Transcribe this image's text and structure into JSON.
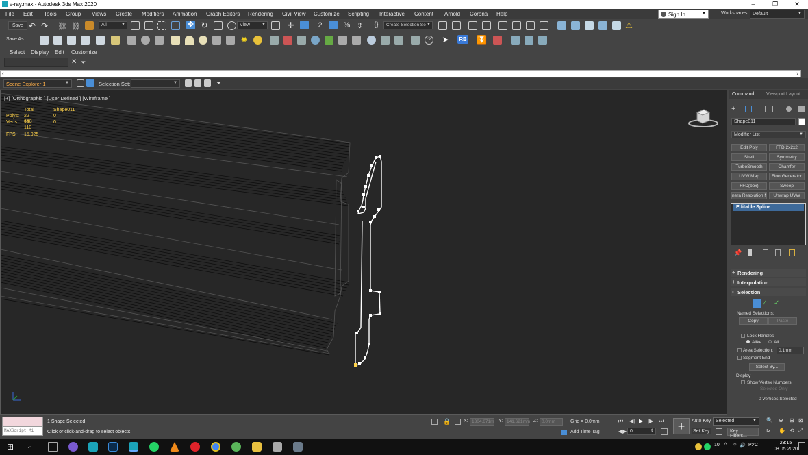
{
  "window": {
    "title": "v-ray.max - Autodesk 3ds Max 2020",
    "min": "–",
    "max": "❐",
    "close": "✕"
  },
  "menu": [
    "File",
    "Edit",
    "Tools",
    "Group",
    "Views",
    "Create",
    "Modifiers",
    "Animation",
    "Graph Editors",
    "Rendering",
    "Civil View",
    "Customize",
    "Scripting",
    "Interactive",
    "Content",
    "Arnold",
    "Corona",
    "Help"
  ],
  "account": {
    "sign_in": "Sign In",
    "workspaces_label": "Workspaces:",
    "workspace": "Default"
  },
  "toolbar": {
    "save": "Save",
    "save_as": "Save As...",
    "filter": "All",
    "view": "View",
    "create_selection_set": "Create Selection Se",
    "rb": "RB"
  },
  "scene_menu": [
    "Select",
    "Display",
    "Edit",
    "Customize"
  ],
  "scene_explorer": {
    "name": "Scene Explorer 1",
    "selection_set_label": "Selection Set:"
  },
  "viewport": {
    "label": "[+] [Orthographic ] [User Defined ] [Wireframe ]",
    "stats": {
      "total_label": "Total",
      "object": "Shape011",
      "polys_label": "Polys:",
      "polys_total": "22 658",
      "polys_obj": "0",
      "verts_label": "Verts:",
      "verts_total": "23 110",
      "verts_obj": "0",
      "fps_label": "FPS:",
      "fps": "15,925"
    }
  },
  "command_panel": {
    "tab_command": "Command ...",
    "tab_layout": "Viewport Layout...",
    "object_name": "Shape011",
    "modifier_list": "Modifier List",
    "modifiers": [
      "Edit Poly",
      "FFD 2x2x2",
      "Shell",
      "Symmetry",
      "TurboSmooth",
      "Chamfer",
      "UVW Map",
      "FloorGenerator",
      "FFD(box)",
      "Sweep",
      "nera Resolution M",
      "Unwrap UVW"
    ],
    "stack_item": "Editable Spline",
    "rollouts": [
      "Rendering",
      "Interpolation",
      "Selection"
    ],
    "named_selections": "Named Selections:",
    "copy": "Copy",
    "paste": "Paste",
    "lock_handles": "Lock Handles",
    "alike": "Alike",
    "all": "All",
    "area_selection": "Area Selection:",
    "area_value": "0,1mm",
    "segment_end": "Segment End",
    "select_by": "Select By...",
    "display": "Display",
    "show_vertex_numbers": "Show Vertex Numbers",
    "selected_only": "Selected Only",
    "vertices_selected": "0 Vertices Selected"
  },
  "status": {
    "maxscript": "MAXScript Mi",
    "shapes_selected": "1 Shape Selected",
    "hint": "Click or click-and-drag to select objects",
    "x_label": "X:",
    "x": "1304,671m",
    "y_label": "Y:",
    "y": "141,621mm",
    "z_label": "Z:",
    "z": "0,0mm",
    "grid": "Grid = 0,0mm",
    "add_time_tag": "Add Time Tag",
    "frame": "0",
    "auto_key": "Auto Key",
    "set_key": "Set Key",
    "selected": "Selected",
    "key_filters": "Key Filters..."
  },
  "taskbar": {
    "lang": "РУС",
    "time": "23:15",
    "date": "08.05.2020",
    "num": "10"
  }
}
